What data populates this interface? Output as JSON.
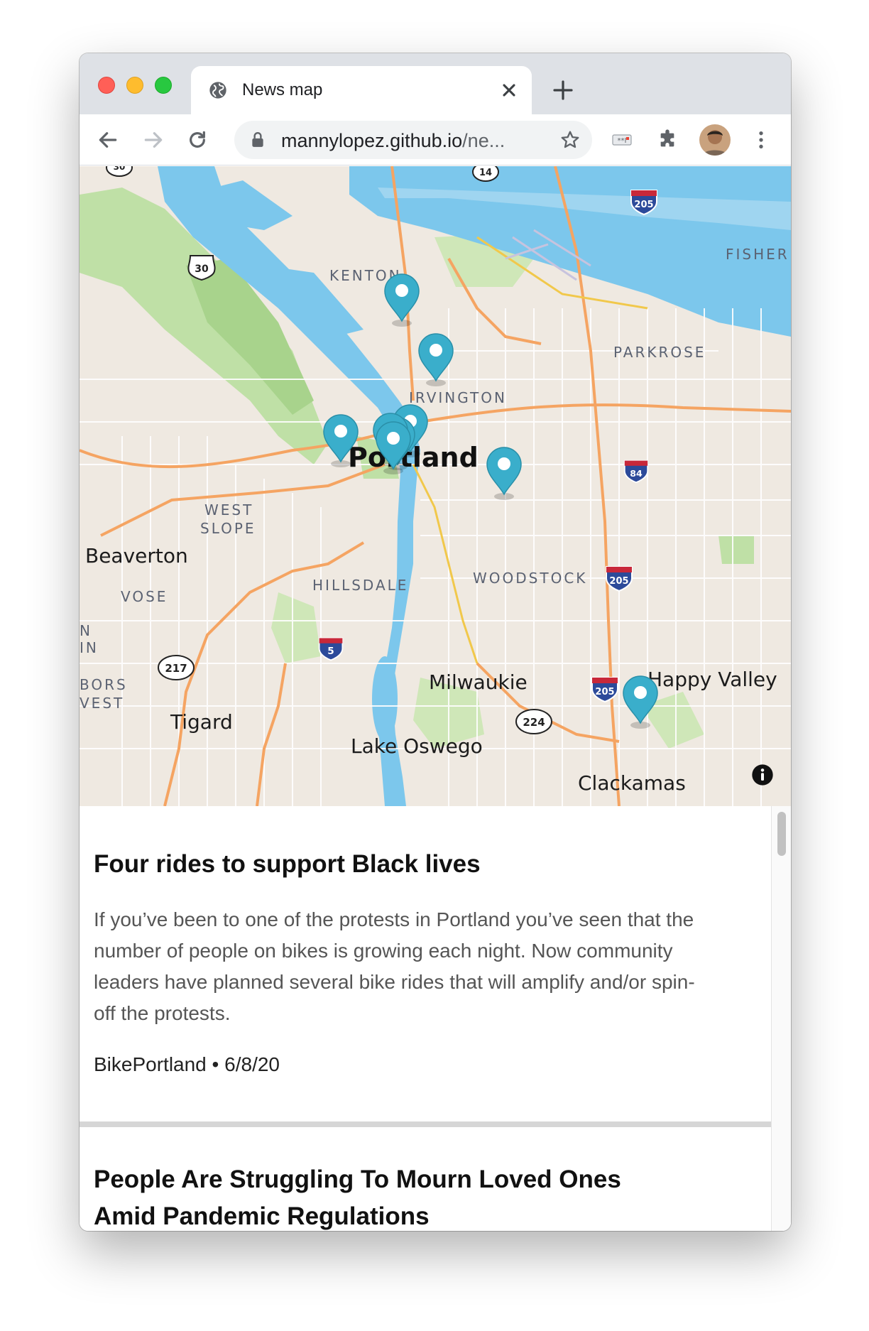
{
  "browser": {
    "tab_title": "News map",
    "url_main": "mannylopez.github.io",
    "url_rest": "/ne..."
  },
  "map": {
    "labels": {
      "portland": "Portland",
      "beaverton": "Beaverton",
      "tigard": "Tigard",
      "lake_oswego": "Lake Oswego",
      "milwaukie": "Milwaukie",
      "happy_valley": "Happy Valley",
      "clackamas": "Clackamas",
      "kenton": "KENTON",
      "irvington": "IRVINGTON",
      "parkrose": "PARKROSE",
      "west_slope_1": "WEST",
      "west_slope_2": "SLOPE",
      "hillsdale": "HILLSDALE",
      "woodstock": "WOODSTOCK",
      "vose": "VOSE",
      "fisher": "FISHER",
      "bors": "BORS",
      "vest": "VEST",
      "edge_n": "N",
      "edge_in": "IN"
    },
    "shields": {
      "i205_top": "205",
      "i205_mid": "205",
      "i205_low": "205",
      "i84": "84",
      "i5": "5",
      "us30": "30",
      "or14": "14",
      "or217": "217",
      "or224": "224",
      "us30_top": "30"
    },
    "pin_color": "#3aaecb",
    "pin_count": 9
  },
  "articles": [
    {
      "title": "Four rides to support Black lives",
      "summary": "If you’ve been to one of the protests in Portland you’ve seen that the number of people on bikes is growing each night. Now community leaders have planned several bike rides that will amplify and/or spin-off the protests.",
      "source": "BikePortland",
      "separator": "•",
      "date": "6/8/20"
    },
    {
      "title": "People Are Struggling To Mourn Loved Ones Amid Pandemic Regulations"
    }
  ]
}
